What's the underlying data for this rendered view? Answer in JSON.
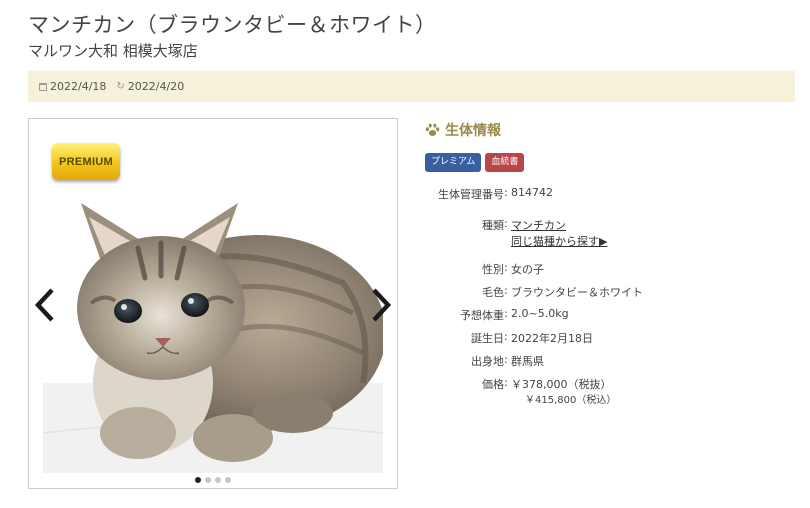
{
  "header": {
    "title": "マンチカン（ブラウンタビー＆ホワイト）",
    "subtitle": "マルワン大和 相模大塚店"
  },
  "dates": {
    "posted": "2022/4/18",
    "updated": "2022/4/20"
  },
  "gallery": {
    "badge": "PREMIUM",
    "slide_count": 4,
    "active_slide": 1
  },
  "info": {
    "section_title": "生体情報",
    "tags": [
      "プレミアム",
      "血統書"
    ],
    "rows": {
      "id": {
        "label": "生体管理番号",
        "value": "814742"
      },
      "breed": {
        "label": "種類",
        "value": "マンチカン",
        "link": "同じ猫種から探す▶"
      },
      "sex": {
        "label": "性別",
        "value": "女の子"
      },
      "color": {
        "label": "毛色",
        "value": "ブラウンタビー＆ホワイト"
      },
      "weight": {
        "label": "予想体重",
        "value": "2.0~5.0kg"
      },
      "birthday": {
        "label": "誕生日",
        "value": "2022年2月18日"
      },
      "origin": {
        "label": "出身地",
        "value": "群馬県"
      },
      "price": {
        "label": "価格",
        "value": "￥378,000（税抜）",
        "value_taxed": "￥415,800（税込）"
      }
    }
  },
  "colors": {
    "accent": "#9a8a4a",
    "datebar_bg": "#f5f2d9",
    "tag_blue": "#3a5fa0",
    "tag_red": "#b7474a"
  }
}
